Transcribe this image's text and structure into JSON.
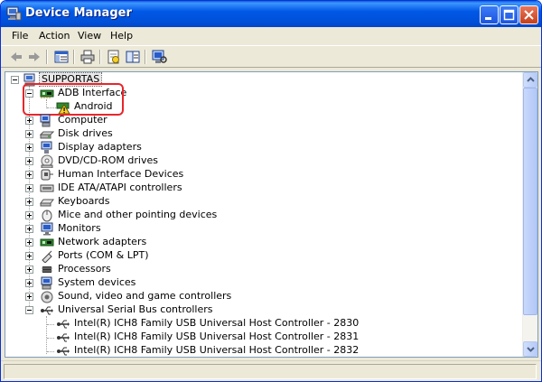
{
  "window": {
    "title": "Device Manager",
    "accent_color": "#0058e6",
    "title_icon": "device-manager-icon"
  },
  "menu": [
    "File",
    "Action",
    "View",
    "Help"
  ],
  "toolbar": {
    "buttons": [
      "back-arrow-icon",
      "forward-arrow-icon",
      "show-hide-console-tree-icon",
      "print-icon",
      "properties-icon",
      "help-icon",
      "scan-hardware-icon"
    ]
  },
  "tree": {
    "root": "SUPPORTAS",
    "adb": {
      "label": "ADB Interface",
      "child": "Android",
      "highlight_color": "#e8262c"
    },
    "categories": [
      "Computer",
      "Disk drives",
      "Display adapters",
      "DVD/CD-ROM drives",
      "Human Interface Devices",
      "IDE ATA/ATAPI controllers",
      "Keyboards",
      "Mice and other pointing devices",
      "Monitors",
      "Network adapters",
      "Ports (COM & LPT)",
      "Processors",
      "System devices",
      "Sound, video and game controllers"
    ],
    "usb": {
      "label": "Universal Serial Bus controllers",
      "children": [
        "Intel(R) ICH8 Family USB Universal Host Controller - 2830",
        "Intel(R) ICH8 Family USB Universal Host Controller - 2831",
        "Intel(R) ICH8 Family USB Universal Host Controller - 2832"
      ]
    }
  }
}
